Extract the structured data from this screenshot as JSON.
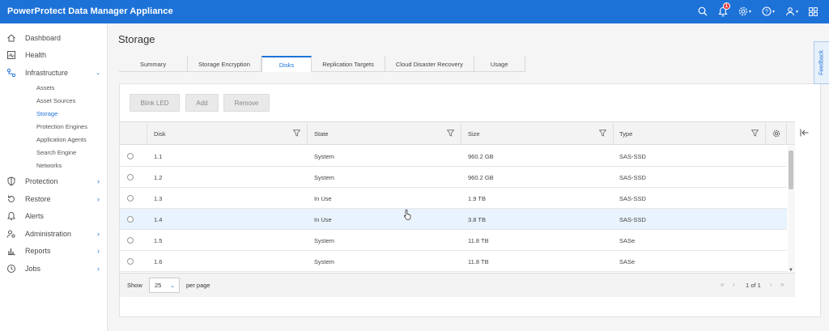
{
  "app_title": "PowerProtect Data Manager Appliance",
  "header_icons": {
    "notification_count": "1"
  },
  "sidebar": {
    "items": [
      {
        "label": "Dashboard",
        "icon": "home-icon"
      },
      {
        "label": "Health",
        "icon": "health-icon"
      },
      {
        "label": "Infrastructure",
        "icon": "infrastructure-icon",
        "expanded": true
      },
      {
        "label": "Protection",
        "icon": "shield-icon"
      },
      {
        "label": "Restore",
        "icon": "restore-icon"
      },
      {
        "label": "Alerts",
        "icon": "bell-icon"
      },
      {
        "label": "Administration",
        "icon": "admin-icon"
      },
      {
        "label": "Reports",
        "icon": "bar-chart-icon"
      },
      {
        "label": "Jobs",
        "icon": "clock-icon"
      }
    ],
    "subitems": [
      "Assets",
      "Asset Sources",
      "Storage",
      "Protection Engines",
      "Application Agents",
      "Search Engine",
      "Networks"
    ],
    "active_subitem": "Storage"
  },
  "page": {
    "title": "Storage",
    "tabs": [
      "Summary",
      "Storage Encryption",
      "Disks",
      "Replication Targets",
      "Cloud Disaster Recovery",
      "Usage"
    ],
    "active_tab": "Disks"
  },
  "toolbar": {
    "blink_led": "Blink LED",
    "add": "Add",
    "remove": "Remove"
  },
  "table": {
    "columns": [
      "Disk",
      "State",
      "Size",
      "Type"
    ],
    "rows": [
      {
        "disk": "1.1",
        "state": "System",
        "size": "960.2 GB",
        "type": "SAS-SSD"
      },
      {
        "disk": "1.2",
        "state": "System",
        "size": "960.2 GB",
        "type": "SAS-SSD"
      },
      {
        "disk": "1.3",
        "state": "In Use",
        "size": "1.9 TB",
        "type": "SAS-SSD"
      },
      {
        "disk": "1.4",
        "state": "In Use",
        "size": "3.8 TB",
        "type": "SAS-SSD"
      },
      {
        "disk": "1.5",
        "state": "System",
        "size": "11.8 TB",
        "type": "SASe"
      },
      {
        "disk": "1.6",
        "state": "System",
        "size": "11.8 TB",
        "type": "SASe"
      }
    ],
    "highlighted_row": "1.4"
  },
  "pagination": {
    "show_label": "Show",
    "page_size": "25",
    "per_page_label": "per page",
    "page_of": "1 of 1"
  },
  "feedback_label": "Feedback",
  "colors": {
    "header": "#1d72d8",
    "accent": "#1d72d8",
    "row_highlight": "#e9f3fd"
  }
}
